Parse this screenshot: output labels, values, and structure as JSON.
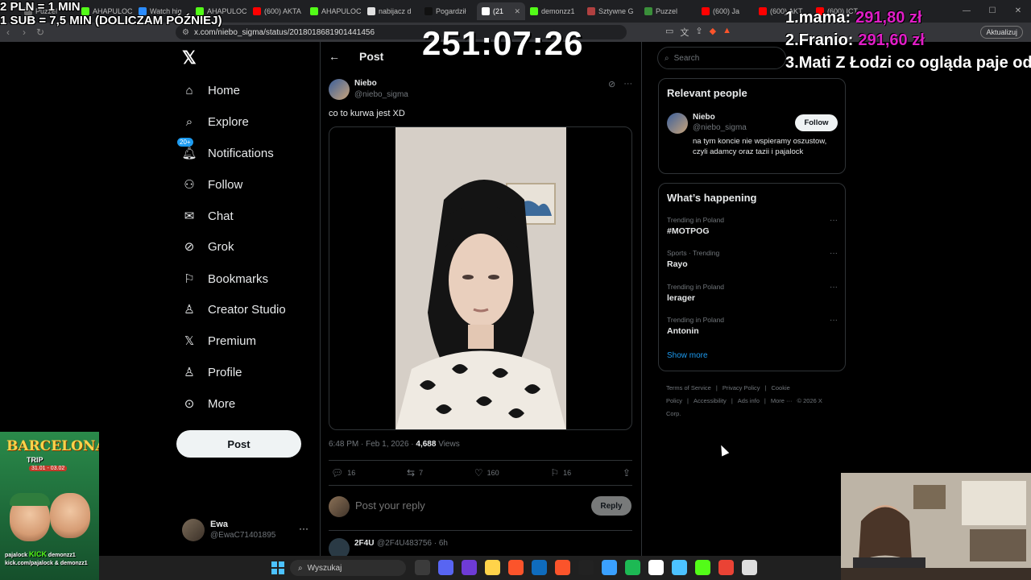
{
  "browser": {
    "tabs": [
      {
        "label": "Puzzel",
        "color": "#6a6a6a"
      },
      {
        "label": "AHAPULOC",
        "color": "#53fc18"
      },
      {
        "label": "Watch hig",
        "color": "#2b8cff"
      },
      {
        "label": "AHAPULOC",
        "color": "#53fc18"
      },
      {
        "label": "(600) AKTA",
        "color": "#ff0000"
      },
      {
        "label": "AHAPULOC",
        "color": "#53fc18"
      },
      {
        "label": "nabijacz d",
        "color": "#e0e0e0"
      },
      {
        "label": "Pogardził",
        "color": "#111111"
      },
      {
        "label": "(21",
        "color": "#ffffff",
        "active": true
      },
      {
        "label": "demonzz1",
        "color": "#53fc18"
      },
      {
        "label": "Sztywne G",
        "color": "#b04040"
      },
      {
        "label": "Puzzel",
        "color": "#3a8f3a"
      },
      {
        "label": "(600) Ja",
        "color": "#ff0000"
      },
      {
        "label": "(600) AKT",
        "color": "#ff0000"
      },
      {
        "label": "(600) ICT",
        "color": "#ff0000"
      }
    ],
    "url": "x.com/niebo_sigma/status/2018018681901441456",
    "update_label": "Aktualizuj"
  },
  "overlay": {
    "rate_line1": "2 PLN = 1 MIN",
    "rate_line2": "1 SUB = 7,5 MIN (DOLICZAM PÓŹNIEJ)",
    "timer": "251:07:26",
    "leaderboard": [
      {
        "rank": "1.",
        "name": "mama:",
        "amount": "291,80 zł"
      },
      {
        "rank": "2.",
        "name": "Franio:",
        "amount": "291,60 zł"
      },
      {
        "rank": "3.",
        "name": "Mati Z Łodzi co ogląda paje od",
        "amount": ""
      }
    ]
  },
  "nav": {
    "items": [
      {
        "label": "Home",
        "icon": "home-icon"
      },
      {
        "label": "Explore",
        "icon": "search-icon"
      },
      {
        "label": "Notifications",
        "icon": "bell-icon",
        "badge": "20+"
      },
      {
        "label": "Follow",
        "icon": "person-add-icon"
      },
      {
        "label": "Chat",
        "icon": "mail-icon"
      },
      {
        "label": "Grok",
        "icon": "grok-icon"
      },
      {
        "label": "Bookmarks",
        "icon": "bookmark-icon"
      },
      {
        "label": "Creator Studio",
        "icon": "creator-icon"
      },
      {
        "label": "Premium",
        "icon": "x-logo-icon"
      },
      {
        "label": "Profile",
        "icon": "person-icon"
      },
      {
        "label": "More",
        "icon": "more-circle-icon"
      }
    ],
    "post_button": "Post",
    "account": {
      "name": "Ewa",
      "handle": "@EwaC71401895"
    }
  },
  "post": {
    "header": "Post",
    "author_name": "Niebo",
    "author_handle": "@niebo_sigma",
    "text": "co to kurwa jest XD",
    "time": "6:48 PM · Feb 1, 2026 ·",
    "views_count": "4,688",
    "views_label": "Views",
    "stats": {
      "replies": "16",
      "reposts": "7",
      "likes": "160",
      "bookmarks": "16"
    },
    "reply_placeholder": "Post your reply",
    "reply_button": "Reply",
    "comment": {
      "name": "2F4U",
      "meta": "@2F4U483756 · 6h"
    }
  },
  "right": {
    "search_placeholder": "Search",
    "relevant_title": "Relevant people",
    "person": {
      "name": "Niebo",
      "handle": "@niebo_sigma",
      "bio": "na tym koncie nie wspieramy oszustow, czyli adamcy oraz tazii i pajalock",
      "follow_label": "Follow"
    },
    "happening_title": "What’s happening",
    "trends": [
      {
        "category": "Trending in Poland",
        "name": "#MOTPOG"
      },
      {
        "category": "Sports · Trending",
        "name": "Rayo"
      },
      {
        "category": "Trending in Poland",
        "name": "lerager"
      },
      {
        "category": "Trending in Poland",
        "name": "Antonin"
      }
    ],
    "show_more": "Show more",
    "footer": [
      "Terms of Service",
      "|",
      "Privacy Policy",
      "|",
      "Cookie Policy",
      "|",
      "Accessibility",
      "|",
      "Ads info",
      "|",
      "More ···",
      "© 2026 X Corp."
    ]
  },
  "promo": {
    "title": "BARCELONA",
    "subtitle": "TRIP",
    "dates": "31.01 - 03.02",
    "name_left": "pajalock",
    "name_right": "demonzz1",
    "kick": "KICK",
    "footer": "kick.com/pajalock & demonzz1"
  },
  "taskbar": {
    "search_placeholder": "Wyszukaj",
    "apps": [
      "#3b3b3b",
      "#5865f2",
      "#6e3bd6",
      "#ffd34a",
      "#fb542b",
      "#0f6cbd",
      "#fb542b",
      "#222222",
      "#3aa0ff",
      "#1db954",
      "#ffffff",
      "#4cc2ff",
      "#53fc18",
      "#ea4335",
      "#dddddd"
    ]
  }
}
